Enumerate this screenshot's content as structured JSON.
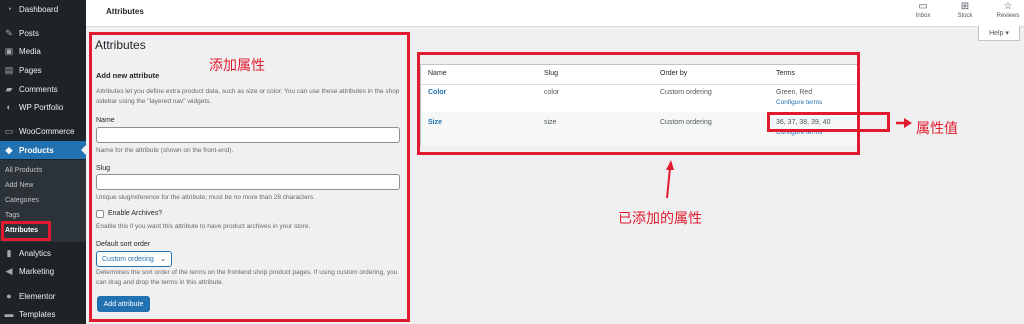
{
  "sidebar": {
    "items": [
      {
        "label": "Dashboard",
        "icon": "dashboard-icon"
      },
      {
        "label": "Posts",
        "icon": "pin-icon"
      },
      {
        "label": "Media",
        "icon": "media-icon"
      },
      {
        "label": "Pages",
        "icon": "page-icon"
      },
      {
        "label": "Comments",
        "icon": "comment-icon"
      },
      {
        "label": "WP Portfolio",
        "icon": "portfolio-icon"
      },
      {
        "label": "WooCommerce",
        "icon": "woo-icon"
      },
      {
        "label": "Products",
        "icon": "products-icon"
      },
      {
        "label": "Analytics",
        "icon": "bar-chart-icon"
      },
      {
        "label": "Marketing",
        "icon": "megaphone-icon"
      },
      {
        "label": "Elementor",
        "icon": "elementor-icon"
      },
      {
        "label": "Templates",
        "icon": "folder-icon"
      }
    ],
    "submenu": [
      "All Products",
      "Add New",
      "Categories",
      "Tags",
      "Attributes"
    ]
  },
  "topbar": {
    "title": "Attributes",
    "actions": [
      {
        "label": "Inbox",
        "icon": "inbox-icon"
      },
      {
        "label": "Stock",
        "icon": "grid-icon"
      },
      {
        "label": "Reviews",
        "icon": "star-icon"
      }
    ],
    "help": "Help ▾"
  },
  "form": {
    "page_title": "Attributes",
    "section_title": "Add new attribute",
    "intro": "Attributes let you define extra product data, such as size or color. You can use these attributes in the shop sidebar using the \"layered nav\" widgets.",
    "name_label": "Name",
    "name_help": "Name for the attribute (shown on the front-end).",
    "slug_label": "Slug",
    "slug_help": "Unique slug/reference for the attribute; must be no more than 28 characters.",
    "archives_label": "Enable Archives?",
    "archives_help": "Enable this if you want this attribute to have product archives in your store.",
    "sort_label": "Default sort order",
    "sort_value": "Custom ordering",
    "sort_help": "Determines the sort order of the terms on the frontend shop product pages. If using custom ordering, you can drag and drop the terms in this attribute.",
    "submit": "Add attribute"
  },
  "table": {
    "headers": [
      "Name",
      "Slug",
      "Order by",
      "Terms"
    ],
    "rows": [
      {
        "name": "Color",
        "slug": "color",
        "order": "Custom ordering",
        "terms": "Green, Red",
        "configure": "Configure terms"
      },
      {
        "name": "Size",
        "slug": "size",
        "order": "Custom ordering",
        "terms": "36, 37, 38, 39, 40",
        "configure": "Configure terms"
      }
    ]
  },
  "annotations": {
    "add_attribute": "添加属性",
    "attribute_values": "属性值",
    "added_attributes": "已添加的属性"
  },
  "colors": {
    "sidebar_bg": "#1d2327",
    "accent": "#2271b1",
    "annotation_red": "#e01b2f"
  }
}
